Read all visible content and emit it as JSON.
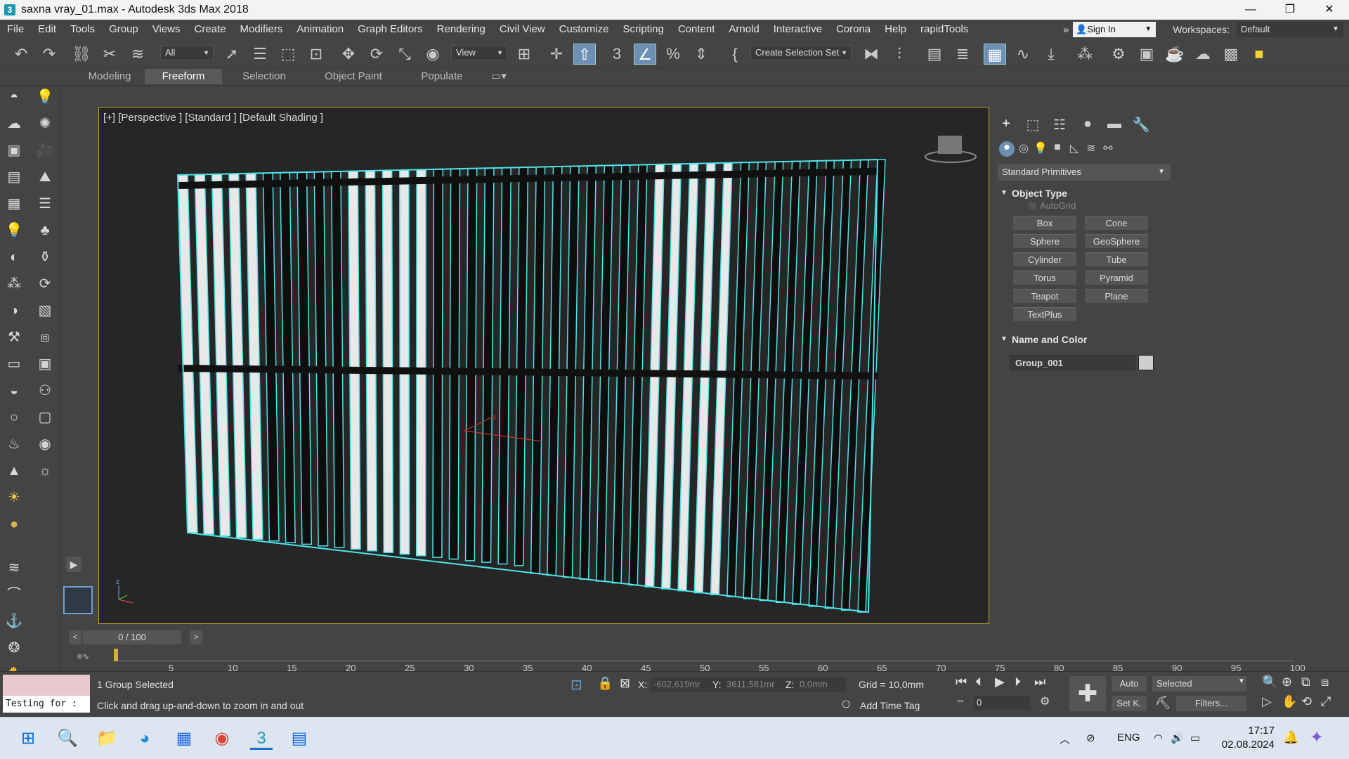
{
  "window": {
    "title": "saxna vray_01.max - Autodesk 3ds Max 2018",
    "app_icon": "3"
  },
  "menu": [
    "File",
    "Edit",
    "Tools",
    "Group",
    "Views",
    "Create",
    "Modifiers",
    "Animation",
    "Graph Editors",
    "Rendering",
    "Civil View",
    "Customize",
    "Scripting",
    "Content",
    "Arnold",
    "Interactive",
    "Corona",
    "Help",
    "rapidTools"
  ],
  "account": {
    "sign_in": "Sign In",
    "workspaces_label": "Workspaces:",
    "workspace": "Default"
  },
  "toolbar": {
    "filter": "All",
    "ref_coord": "View",
    "selection_set": "Create Selection Set"
  },
  "ribbon_tabs": [
    "Modeling",
    "Freeform",
    "Selection",
    "Object Paint",
    "Populate"
  ],
  "viewport": {
    "label": "[+] [Perspective ] [Standard ] [Default Shading ]",
    "accent": "#4fe3e8"
  },
  "command_panel": {
    "category": "Standard Primitives",
    "object_type_title": "Object Type",
    "autogrid": "AutoGrid",
    "buttons": [
      "Box",
      "Cone",
      "Sphere",
      "GeoSphere",
      "Cylinder",
      "Tube",
      "Torus",
      "Pyramid",
      "Teapot",
      "Plane",
      "TextPlus"
    ],
    "name_color_title": "Name and Color",
    "object_name": "Group_001"
  },
  "timeline": {
    "frame": "0 / 100",
    "ticks": [
      "5",
      "10",
      "15",
      "20",
      "25",
      "30",
      "35",
      "40",
      "45",
      "50",
      "55",
      "60",
      "65",
      "70",
      "75",
      "80",
      "85",
      "90",
      "95",
      "100"
    ]
  },
  "status": {
    "script_text": "Testing for :",
    "selection": "1 Group Selected",
    "prompt": "Click and drag up-and-down to zoom in and out",
    "x_label": "X:",
    "x": "-602,619mr",
    "y_label": "Y:",
    "y": "3611,581mr",
    "z_label": "Z:",
    "z": "0,0mm",
    "grid": "Grid = 10,0mm",
    "add_time_tag": "Add Time Tag",
    "auto": "Auto",
    "set_key": "Set K.",
    "key_filter": "Selected",
    "filters": "Filters...",
    "frame_value": "0"
  },
  "taskbar": {
    "lang": "ENG",
    "time": "17:17",
    "date": "02.08.2024"
  }
}
